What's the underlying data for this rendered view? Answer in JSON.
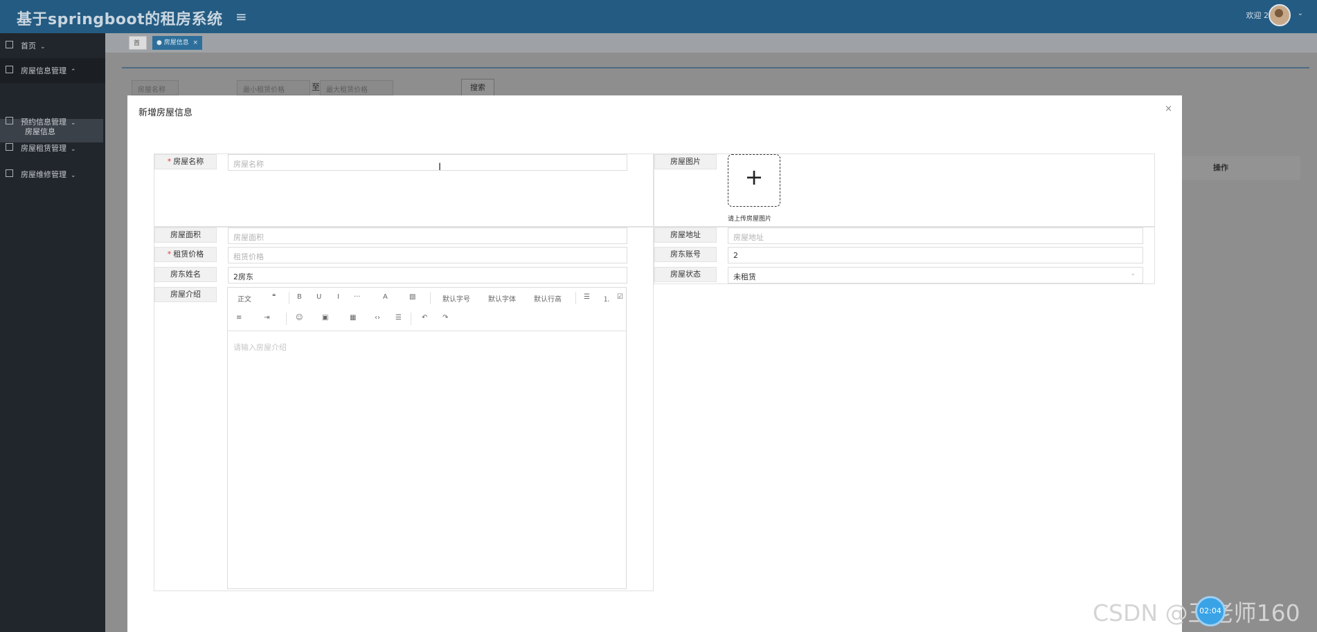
{
  "app": {
    "title": "基于springboot的租房系统",
    "welcome": "欢迎 2"
  },
  "sidebar": {
    "items": [
      {
        "label": "首页"
      },
      {
        "label": "房屋信息管理"
      },
      {
        "label": "预约信息管理"
      },
      {
        "label": "房屋租赁管理"
      },
      {
        "label": "房屋维修管理"
      }
    ],
    "sub_item": "房屋信息"
  },
  "tabs": {
    "home": "首页",
    "active": "房屋信息",
    "close": "×"
  },
  "filter": {
    "name_placeholder": "房屋名称",
    "min_price_placeholder": "最小租赁价格",
    "to": "至",
    "max_price_placeholder": "最大租赁价格",
    "search_button": "搜索"
  },
  "table": {
    "operation_header": "操作"
  },
  "modal": {
    "title": "新增房屋信息",
    "close": "×",
    "fields": {
      "house_name": {
        "label": "房屋名称",
        "placeholder": "房屋名称",
        "required_mark": "*"
      },
      "house_image": {
        "label": "房屋图片",
        "upload_hint": "请上传房屋图片",
        "plus": "+"
      },
      "house_area": {
        "label": "房屋面积",
        "placeholder": "房屋面积"
      },
      "house_address": {
        "label": "房屋地址",
        "placeholder": "房屋地址"
      },
      "rent_price": {
        "label": "租赁价格",
        "placeholder": "租赁价格",
        "required_mark": "*"
      },
      "landlord_account": {
        "label": "房东账号",
        "value": "2"
      },
      "landlord_name": {
        "label": "房东姓名",
        "value": "2房东"
      },
      "house_status": {
        "label": "房屋状态",
        "value": "未租赁"
      },
      "house_intro": {
        "label": "房屋介绍",
        "placeholder": "请输入房屋介绍"
      }
    },
    "editor_toolbar": {
      "row1": [
        "正文",
        "❝",
        "B",
        "U",
        "I",
        "···",
        "A",
        "▧",
        "默认字号",
        "默认字体",
        "默认行高",
        "☰",
        "⒈",
        "☑"
      ],
      "row2": [
        "≡",
        "⇥",
        "☺",
        "▣",
        "▦",
        "‹›",
        "☰",
        "↶",
        "↷"
      ]
    }
  },
  "watermark": "CSDN @王老师160",
  "float_ball": "02:04"
}
